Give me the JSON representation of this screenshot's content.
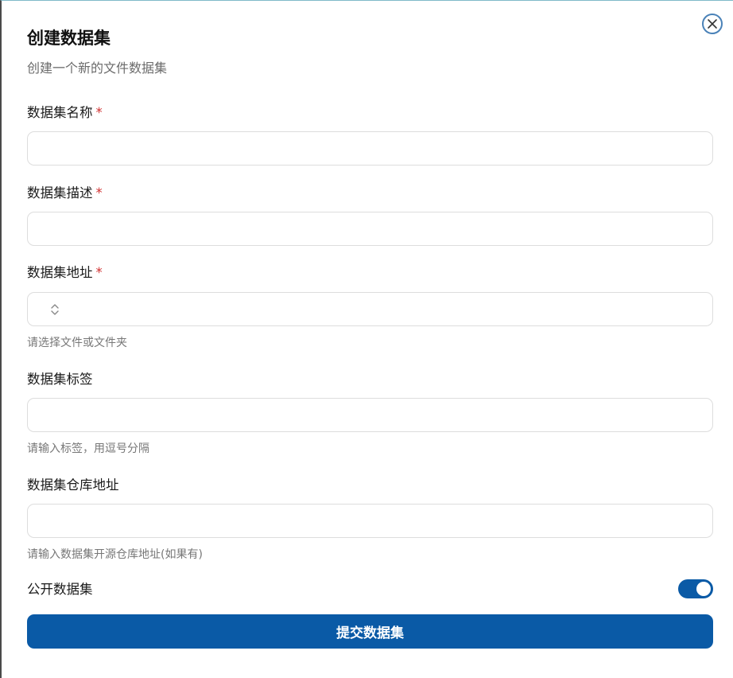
{
  "dialog": {
    "title": "创建数据集",
    "subtitle": "创建一个新的文件数据集",
    "close_icon": "close-icon"
  },
  "form": {
    "name": {
      "label": "数据集名称",
      "required_mark": "*",
      "value": ""
    },
    "description": {
      "label": "数据集描述",
      "required_mark": "*",
      "value": ""
    },
    "address": {
      "label": "数据集地址",
      "required_mark": "*",
      "selected": "",
      "hint": "请选择文件或文件夹",
      "icon": "chevron-up-down-icon"
    },
    "tags": {
      "label": "数据集标签",
      "value": "",
      "hint": "请输入标签，用逗号分隔"
    },
    "repo": {
      "label": "数据集仓库地址",
      "value": "",
      "hint": "请输入数据集开源仓库地址(如果有)"
    },
    "public": {
      "label": "公开数据集",
      "enabled": true
    },
    "submit_label": "提交数据集"
  },
  "colors": {
    "primary": "#0a5aa6",
    "required": "#d03030",
    "hint": "#777777"
  }
}
